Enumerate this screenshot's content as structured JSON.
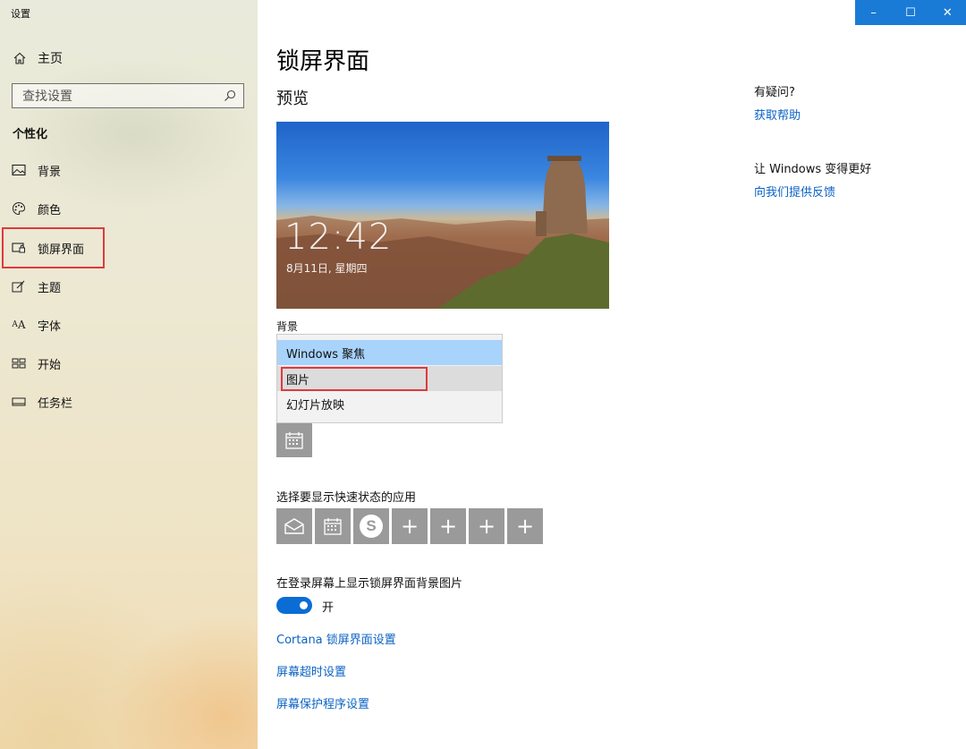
{
  "app": {
    "title": "设置"
  },
  "window_controls": {
    "minimize": "–",
    "maximize": "☐",
    "close": "✕"
  },
  "sidebar": {
    "home_label": "主页",
    "search_placeholder": "查找设置",
    "section_title": "个性化",
    "items": [
      {
        "label": "背景",
        "icon": "image-icon"
      },
      {
        "label": "颜色",
        "icon": "palette-icon"
      },
      {
        "label": "锁屏界面",
        "icon": "lock-screen-icon",
        "active": true
      },
      {
        "label": "主题",
        "icon": "theme-icon"
      },
      {
        "label": "字体",
        "icon": "font-icon"
      },
      {
        "label": "开始",
        "icon": "start-icon"
      },
      {
        "label": "任务栏",
        "icon": "taskbar-icon"
      }
    ]
  },
  "main": {
    "title": "锁屏界面",
    "preview_label": "预览",
    "preview_time": "12:42",
    "preview_date": "8月11日, 星期四",
    "background_label": "背景",
    "background_options": [
      "Windows 聚焦",
      "图片",
      "幻灯片放映"
    ],
    "quick_status_label": "选择要显示快速状态的应用",
    "quick_status_apps": [
      {
        "icon": "mail-icon",
        "symbol": ""
      },
      {
        "icon": "calendar-icon",
        "symbol": ""
      },
      {
        "icon": "skype-icon",
        "symbol": "S"
      },
      {
        "icon": "plus-icon",
        "symbol": "+"
      },
      {
        "icon": "plus-icon",
        "symbol": "+"
      },
      {
        "icon": "plus-icon",
        "symbol": "+"
      },
      {
        "icon": "plus-icon",
        "symbol": "+"
      }
    ],
    "login_bg_label": "在登录屏幕上显示锁屏界面背景图片",
    "login_bg_state": "开",
    "links": [
      "Cortana 锁屏界面设置",
      "屏幕超时设置",
      "屏幕保护程序设置"
    ]
  },
  "help": {
    "question": "有疑问?",
    "get_help": "获取帮助",
    "improve": "让 Windows 变得更好",
    "feedback": "向我们提供反馈"
  },
  "colors": {
    "accent": "#0a6cd5",
    "link": "#0b63c4",
    "highlight_red": "#e0393e",
    "selected_option": "#a8d3fb"
  }
}
